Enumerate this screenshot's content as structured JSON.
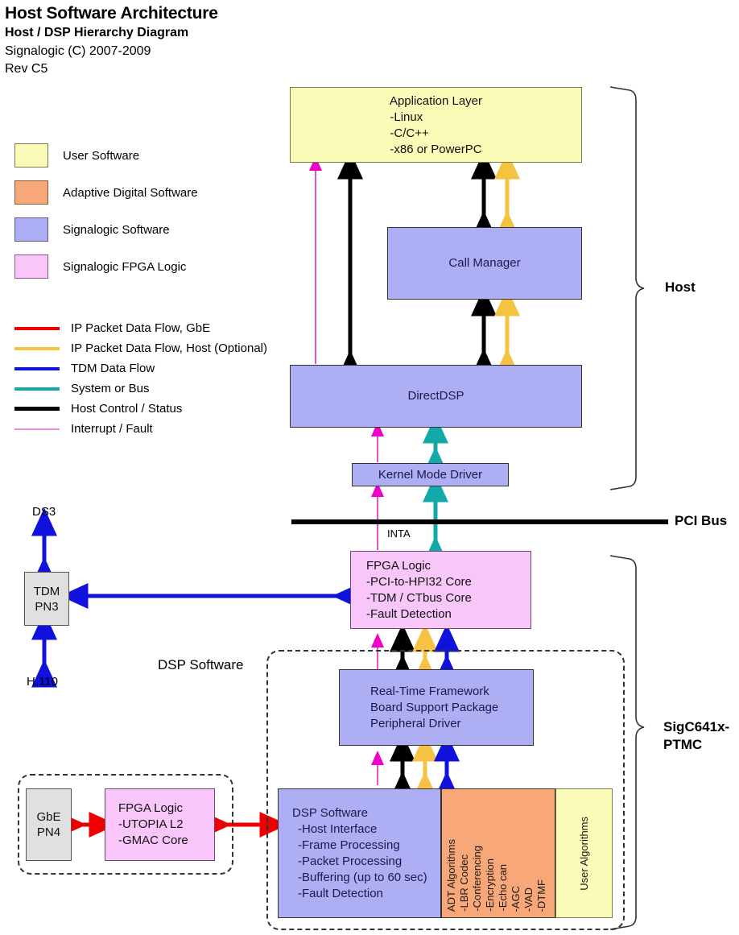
{
  "header": {
    "title": "Host Software Architecture",
    "subtitle": "Host / DSP Hierarchy Diagram",
    "copyright": "Signalogic (C) 2007-2009",
    "revision": "Rev C5"
  },
  "legend": {
    "swatches": [
      {
        "label": "User Software",
        "color": "#fbfbb8",
        "border": "#7a7a4d"
      },
      {
        "label": "Adaptive Digital Software",
        "color": "#f8a878",
        "border": "#8a5a3a"
      },
      {
        "label": "Signalogic Software",
        "color": "#aeaef4",
        "border": "#5a5a8a"
      },
      {
        "label": "Signalogic FPGA Logic",
        "color": "#f9c6f9",
        "border": "#8a5a8a"
      }
    ],
    "lines": [
      {
        "label": "IP Packet Data Flow, GbE",
        "color": "#ee0000",
        "width": 4
      },
      {
        "label": "IP Packet Data Flow, Host (Optional)",
        "color": "#f5c242",
        "width": 4
      },
      {
        "label": "TDM Data Flow",
        "color": "#1111dd",
        "width": 4
      },
      {
        "label": "System or Bus",
        "color": "#13a9a9",
        "width": 4
      },
      {
        "label": "Host Control / Status",
        "color": "#000000",
        "width": 5
      },
      {
        "label": "Interrupt / Fault",
        "color": "#e88fd8",
        "width": 2
      }
    ]
  },
  "blocks": {
    "application_layer": {
      "lines": [
        "Application Layer",
        "-Linux",
        "-C/C++",
        "-x86 or PowerPC"
      ],
      "fill": "#fbfbb8"
    },
    "call_manager": {
      "lines": [
        "Call Manager"
      ],
      "fill": "#aeaef4"
    },
    "directdsp": {
      "lines": [
        "DirectDSP"
      ],
      "fill": "#aeaef4"
    },
    "kernel_driver": {
      "lines": [
        "Kernel Mode Driver"
      ],
      "fill": "#aeaef4"
    },
    "fpga_logic_main": {
      "lines": [
        "FPGA Logic",
        "-PCI-to-HPI32 Core",
        "-TDM / CTbus Core",
        "-Fault Detection"
      ],
      "fill": "#f9c6f9"
    },
    "rtf": {
      "lines": [
        "Real-Time Framework",
        "Board Support Package",
        "Peripheral Driver"
      ],
      "fill": "#aeaef4"
    },
    "dsp_software": {
      "lines": [
        "DSP Software",
        "-Host Interface",
        "-Frame Processing",
        "-Packet Processing",
        "-Buffering (up to 60 sec)",
        "-Fault Detection"
      ],
      "fill": "#aeaef4"
    },
    "adt_algorithms": {
      "columns": [
        "ADT Algorithms",
        "-LBR Codec",
        "-Conferencing",
        "-Encryption",
        "-Echo can",
        "-AGC",
        "-VAD",
        "-DTMF"
      ],
      "fill": "#f8a878"
    },
    "user_algorithms": {
      "lines": [
        "User Algorithms"
      ],
      "fill": "#fbfbb8"
    },
    "tdm_pn3": {
      "lines": [
        "TDM",
        "PN3"
      ],
      "fill": "#e0e0e0"
    },
    "gbe_pn4": {
      "lines": [
        "GbE",
        "PN4"
      ],
      "fill": "#e0e0e0"
    },
    "fpga_logic_gbe": {
      "lines": [
        "FPGA Logic",
        "-UTOPIA L2",
        "-GMAC Core"
      ],
      "fill": "#f9c6f9"
    }
  },
  "labels": {
    "host": "Host",
    "pci_bus": "PCI Bus",
    "sigc_line1": "SigC641x-",
    "sigc_line2": "PTMC",
    "dsp_software_group": "DSP Software",
    "inta": "INTA",
    "ds3": "DS3",
    "h110": "H.110"
  }
}
